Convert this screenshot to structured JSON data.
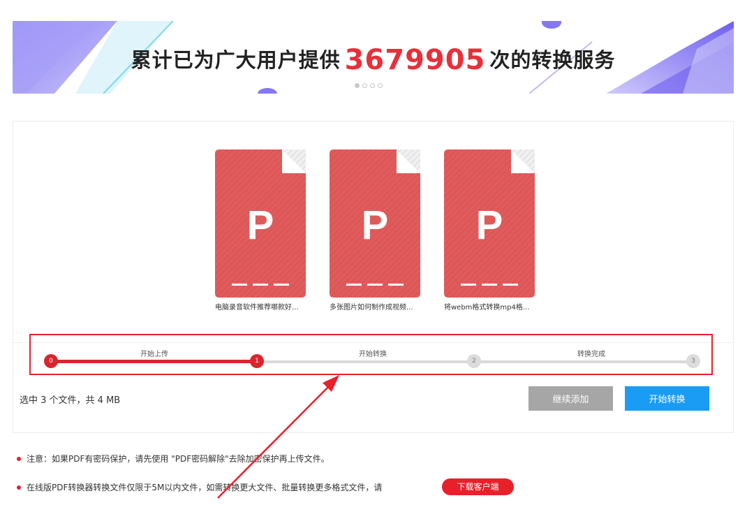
{
  "banner": {
    "prefix": "累计已为广大用户提供",
    "count": "3679905",
    "suffix": "次的转换服务"
  },
  "files": [
    {
      "icon_letter": "P",
      "name": "电脑录音软件推荐哪款好..."
    },
    {
      "icon_letter": "P",
      "name": "多张图片如何制作成视频..."
    },
    {
      "icon_letter": "P",
      "name": "将webm格式转换mp4格..."
    }
  ],
  "steps": {
    "labels": [
      "开始上传",
      "开始转换",
      "转换完成"
    ],
    "nodes": [
      "0",
      "1",
      "2",
      "3"
    ],
    "current_step": 1,
    "total_steps": 3
  },
  "summary": "选中 3 个文件，共 4 MB",
  "buttons": {
    "continue_add": "继续添加",
    "start_convert": "开始转换",
    "download_client": "下载客户端"
  },
  "notes": {
    "note1": "注意：如果PDF有密码保护，请先使用 \"PDF密码解除\"去除加密保护再上传文件。",
    "note2": "在线版PDF转换器转换文件仅限于5M以内文件，如需转换更大文件、批量转换更多格式文件，请"
  },
  "colors": {
    "accent_red": "#e8202a",
    "primary_blue": "#1a9cf5",
    "file_red": "#e05a5a",
    "banner_purple": "#7b6cf0"
  }
}
